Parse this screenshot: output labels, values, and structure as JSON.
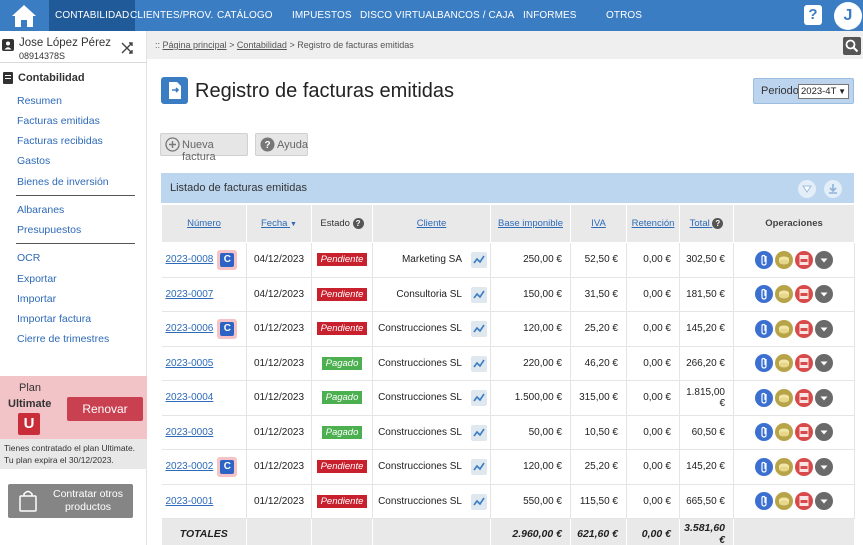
{
  "nav": {
    "items": [
      "CONTABILIDAD",
      "CLIENTES/PROV.",
      "CATÁLOGO",
      "IMPUESTOS",
      "DISCO VIRTUAL",
      "BANCOS / CAJA",
      "INFORMES",
      "OTROS"
    ],
    "help_label": "?",
    "user_initial": "J"
  },
  "user": {
    "name": "Jose López Pérez",
    "id": "08914378S"
  },
  "sidebar": {
    "section_title": "Contabilidad",
    "group1": [
      "Resumen",
      "Facturas emitidas",
      "Facturas recibidas",
      "Gastos",
      "Bienes de inversión"
    ],
    "group2": [
      "Albaranes",
      "Presupuestos"
    ],
    "group3": [
      "OCR",
      "Exportar",
      "Importar",
      "Importar factura",
      "Cierre de trimestres"
    ]
  },
  "plan": {
    "label": "Plan",
    "name": "Ultimate",
    "badge": "U",
    "renew_label": "Renovar",
    "info_line1": "Tienes contratado el plan Ultimate.",
    "info_line2": "Tu plan expira el 30/12/2023.",
    "buy_label": "Contratar otros productos"
  },
  "breadcrumb": {
    "prefix": "::",
    "home": "Página principal",
    "section": "Contabilidad",
    "current": "Registro de facturas emitidas",
    "sep": ">"
  },
  "page": {
    "title": "Registro de facturas emitidas",
    "period_label": "Periodo",
    "period_value": "2023-4T"
  },
  "toolbar": {
    "new_label": "Nueva factura",
    "help_label": "Ayuda"
  },
  "list": {
    "title": "Listado de facturas emitidas",
    "headers": {
      "numero": "Número",
      "fecha": "Fecha",
      "estado": "Estado",
      "cliente": "Cliente",
      "base": "Base imponible",
      "iva": "IVA",
      "retencion": "Retención",
      "total": "Total",
      "operaciones": "Operaciones"
    },
    "rows": [
      {
        "numero": "2023-0008",
        "c": true,
        "fecha": "04/12/2023",
        "estado": "Pendiente",
        "cliente": "Marketing SA",
        "base": "250,00 €",
        "iva": "52,50 €",
        "ret": "0,00 €",
        "total": "302,50 €"
      },
      {
        "numero": "2023-0007",
        "c": false,
        "fecha": "04/12/2023",
        "estado": "Pendiente",
        "cliente": "Consultoria SL",
        "base": "150,00 €",
        "iva": "31,50 €",
        "ret": "0,00 €",
        "total": "181,50 €"
      },
      {
        "numero": "2023-0006",
        "c": true,
        "fecha": "01/12/2023",
        "estado": "Pendiente",
        "cliente": "Construcciones SL",
        "base": "120,00 €",
        "iva": "25,20 €",
        "ret": "0,00 €",
        "total": "145,20 €"
      },
      {
        "numero": "2023-0005",
        "c": false,
        "fecha": "01/12/2023",
        "estado": "Pagado",
        "cliente": "Construcciones SL",
        "base": "220,00 €",
        "iva": "46,20 €",
        "ret": "0,00 €",
        "total": "266,20 €"
      },
      {
        "numero": "2023-0004",
        "c": false,
        "fecha": "01/12/2023",
        "estado": "Pagado",
        "cliente": "Construcciones SL",
        "base": "1.500,00 €",
        "iva": "315,00 €",
        "ret": "0,00 €",
        "total": "1.815,00 €"
      },
      {
        "numero": "2023-0003",
        "c": false,
        "fecha": "01/12/2023",
        "estado": "Pagado",
        "cliente": "Construcciones SL",
        "base": "50,00 €",
        "iva": "10,50 €",
        "ret": "0,00 €",
        "total": "60,50 €"
      },
      {
        "numero": "2023-0002",
        "c": true,
        "fecha": "01/12/2023",
        "estado": "Pendiente",
        "cliente": "Construcciones SL",
        "base": "120,00 €",
        "iva": "25,20 €",
        "ret": "0,00 €",
        "total": "145,20 €"
      },
      {
        "numero": "2023-0001",
        "c": false,
        "fecha": "01/12/2023",
        "estado": "Pendiente",
        "cliente": "Construcciones SL",
        "base": "550,00 €",
        "iva": "115,50 €",
        "ret": "0,00 €",
        "total": "665,50 €"
      }
    ],
    "c_badge": "C",
    "totals": {
      "label": "TOTALES",
      "base": "2.960,00 €",
      "iva": "621,60 €",
      "ret": "0,00 €",
      "total": "3.581,60 €"
    }
  },
  "colors": {
    "brand": "#3b7dc3",
    "pending": "#c8212d",
    "paid": "#4caf50"
  }
}
